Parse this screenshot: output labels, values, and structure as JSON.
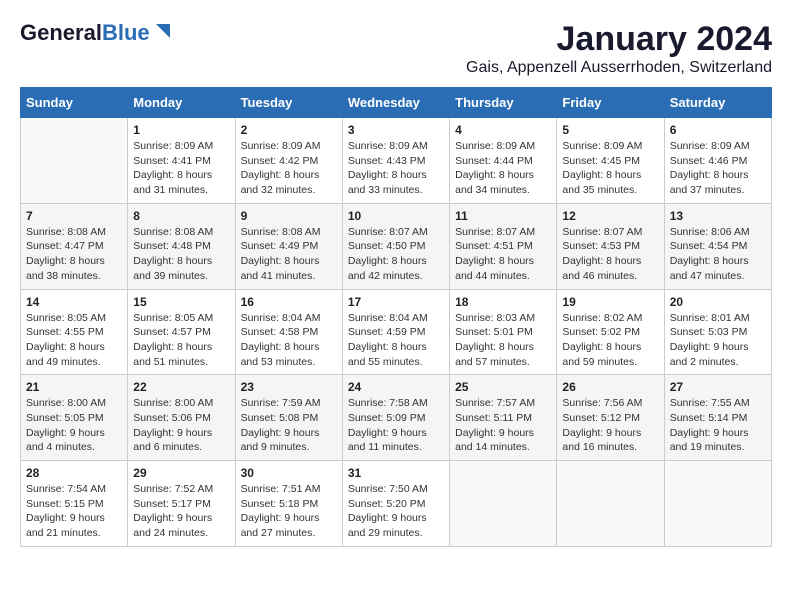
{
  "header": {
    "logo_general": "General",
    "logo_blue": "Blue",
    "month_title": "January 2024",
    "subtitle": "Gais, Appenzell Ausserrhoden, Switzerland"
  },
  "days_of_week": [
    "Sunday",
    "Monday",
    "Tuesday",
    "Wednesday",
    "Thursday",
    "Friday",
    "Saturday"
  ],
  "weeks": [
    [
      {
        "num": "",
        "sunrise": "",
        "sunset": "",
        "daylight": ""
      },
      {
        "num": "1",
        "sunrise": "Sunrise: 8:09 AM",
        "sunset": "Sunset: 4:41 PM",
        "daylight": "Daylight: 8 hours and 31 minutes."
      },
      {
        "num": "2",
        "sunrise": "Sunrise: 8:09 AM",
        "sunset": "Sunset: 4:42 PM",
        "daylight": "Daylight: 8 hours and 32 minutes."
      },
      {
        "num": "3",
        "sunrise": "Sunrise: 8:09 AM",
        "sunset": "Sunset: 4:43 PM",
        "daylight": "Daylight: 8 hours and 33 minutes."
      },
      {
        "num": "4",
        "sunrise": "Sunrise: 8:09 AM",
        "sunset": "Sunset: 4:44 PM",
        "daylight": "Daylight: 8 hours and 34 minutes."
      },
      {
        "num": "5",
        "sunrise": "Sunrise: 8:09 AM",
        "sunset": "Sunset: 4:45 PM",
        "daylight": "Daylight: 8 hours and 35 minutes."
      },
      {
        "num": "6",
        "sunrise": "Sunrise: 8:09 AM",
        "sunset": "Sunset: 4:46 PM",
        "daylight": "Daylight: 8 hours and 37 minutes."
      }
    ],
    [
      {
        "num": "7",
        "sunrise": "Sunrise: 8:08 AM",
        "sunset": "Sunset: 4:47 PM",
        "daylight": "Daylight: 8 hours and 38 minutes."
      },
      {
        "num": "8",
        "sunrise": "Sunrise: 8:08 AM",
        "sunset": "Sunset: 4:48 PM",
        "daylight": "Daylight: 8 hours and 39 minutes."
      },
      {
        "num": "9",
        "sunrise": "Sunrise: 8:08 AM",
        "sunset": "Sunset: 4:49 PM",
        "daylight": "Daylight: 8 hours and 41 minutes."
      },
      {
        "num": "10",
        "sunrise": "Sunrise: 8:07 AM",
        "sunset": "Sunset: 4:50 PM",
        "daylight": "Daylight: 8 hours and 42 minutes."
      },
      {
        "num": "11",
        "sunrise": "Sunrise: 8:07 AM",
        "sunset": "Sunset: 4:51 PM",
        "daylight": "Daylight: 8 hours and 44 minutes."
      },
      {
        "num": "12",
        "sunrise": "Sunrise: 8:07 AM",
        "sunset": "Sunset: 4:53 PM",
        "daylight": "Daylight: 8 hours and 46 minutes."
      },
      {
        "num": "13",
        "sunrise": "Sunrise: 8:06 AM",
        "sunset": "Sunset: 4:54 PM",
        "daylight": "Daylight: 8 hours and 47 minutes."
      }
    ],
    [
      {
        "num": "14",
        "sunrise": "Sunrise: 8:05 AM",
        "sunset": "Sunset: 4:55 PM",
        "daylight": "Daylight: 8 hours and 49 minutes."
      },
      {
        "num": "15",
        "sunrise": "Sunrise: 8:05 AM",
        "sunset": "Sunset: 4:57 PM",
        "daylight": "Daylight: 8 hours and 51 minutes."
      },
      {
        "num": "16",
        "sunrise": "Sunrise: 8:04 AM",
        "sunset": "Sunset: 4:58 PM",
        "daylight": "Daylight: 8 hours and 53 minutes."
      },
      {
        "num": "17",
        "sunrise": "Sunrise: 8:04 AM",
        "sunset": "Sunset: 4:59 PM",
        "daylight": "Daylight: 8 hours and 55 minutes."
      },
      {
        "num": "18",
        "sunrise": "Sunrise: 8:03 AM",
        "sunset": "Sunset: 5:01 PM",
        "daylight": "Daylight: 8 hours and 57 minutes."
      },
      {
        "num": "19",
        "sunrise": "Sunrise: 8:02 AM",
        "sunset": "Sunset: 5:02 PM",
        "daylight": "Daylight: 8 hours and 59 minutes."
      },
      {
        "num": "20",
        "sunrise": "Sunrise: 8:01 AM",
        "sunset": "Sunset: 5:03 PM",
        "daylight": "Daylight: 9 hours and 2 minutes."
      }
    ],
    [
      {
        "num": "21",
        "sunrise": "Sunrise: 8:00 AM",
        "sunset": "Sunset: 5:05 PM",
        "daylight": "Daylight: 9 hours and 4 minutes."
      },
      {
        "num": "22",
        "sunrise": "Sunrise: 8:00 AM",
        "sunset": "Sunset: 5:06 PM",
        "daylight": "Daylight: 9 hours and 6 minutes."
      },
      {
        "num": "23",
        "sunrise": "Sunrise: 7:59 AM",
        "sunset": "Sunset: 5:08 PM",
        "daylight": "Daylight: 9 hours and 9 minutes."
      },
      {
        "num": "24",
        "sunrise": "Sunrise: 7:58 AM",
        "sunset": "Sunset: 5:09 PM",
        "daylight": "Daylight: 9 hours and 11 minutes."
      },
      {
        "num": "25",
        "sunrise": "Sunrise: 7:57 AM",
        "sunset": "Sunset: 5:11 PM",
        "daylight": "Daylight: 9 hours and 14 minutes."
      },
      {
        "num": "26",
        "sunrise": "Sunrise: 7:56 AM",
        "sunset": "Sunset: 5:12 PM",
        "daylight": "Daylight: 9 hours and 16 minutes."
      },
      {
        "num": "27",
        "sunrise": "Sunrise: 7:55 AM",
        "sunset": "Sunset: 5:14 PM",
        "daylight": "Daylight: 9 hours and 19 minutes."
      }
    ],
    [
      {
        "num": "28",
        "sunrise": "Sunrise: 7:54 AM",
        "sunset": "Sunset: 5:15 PM",
        "daylight": "Daylight: 9 hours and 21 minutes."
      },
      {
        "num": "29",
        "sunrise": "Sunrise: 7:52 AM",
        "sunset": "Sunset: 5:17 PM",
        "daylight": "Daylight: 9 hours and 24 minutes."
      },
      {
        "num": "30",
        "sunrise": "Sunrise: 7:51 AM",
        "sunset": "Sunset: 5:18 PM",
        "daylight": "Daylight: 9 hours and 27 minutes."
      },
      {
        "num": "31",
        "sunrise": "Sunrise: 7:50 AM",
        "sunset": "Sunset: 5:20 PM",
        "daylight": "Daylight: 9 hours and 29 minutes."
      },
      {
        "num": "",
        "sunrise": "",
        "sunset": "",
        "daylight": ""
      },
      {
        "num": "",
        "sunrise": "",
        "sunset": "",
        "daylight": ""
      },
      {
        "num": "",
        "sunrise": "",
        "sunset": "",
        "daylight": ""
      }
    ]
  ]
}
